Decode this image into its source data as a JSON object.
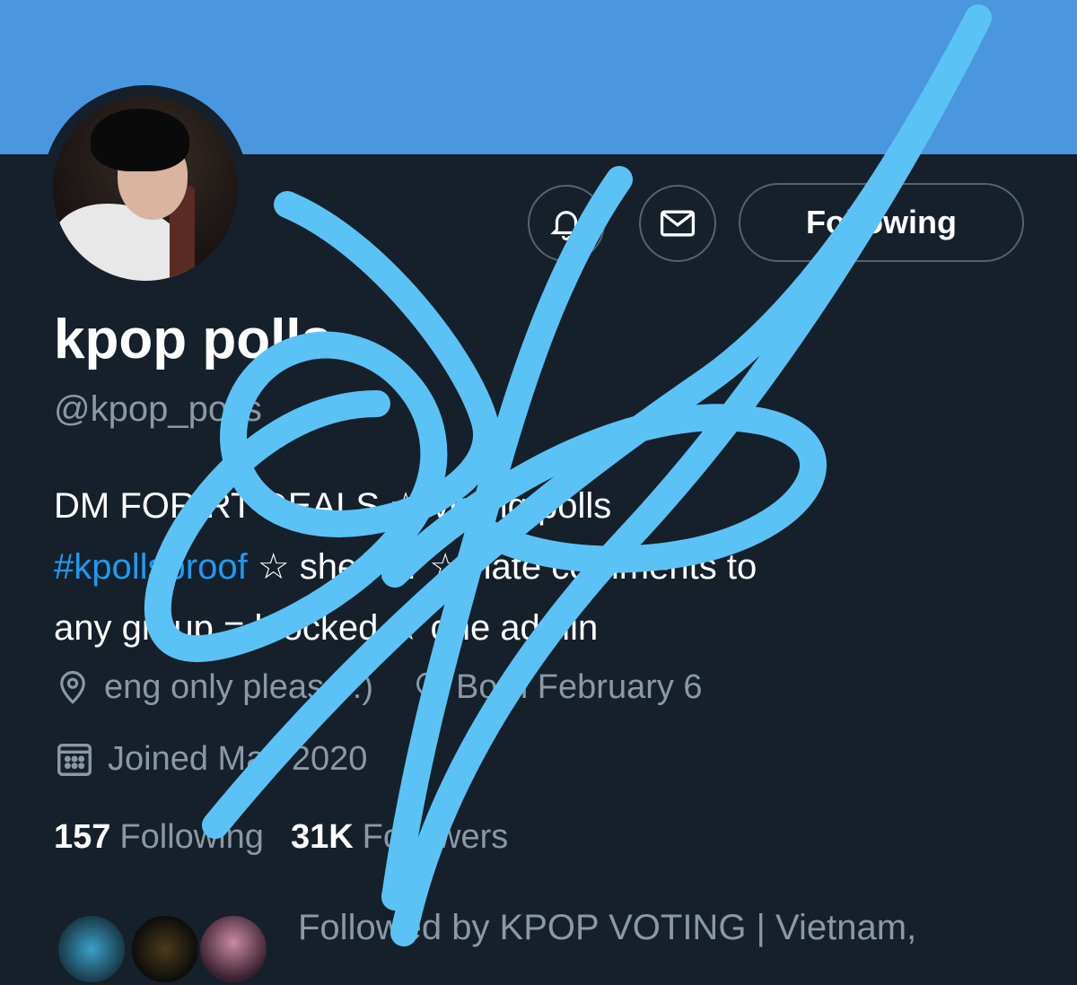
{
  "profile": {
    "name": "kpop polls",
    "handle": "@kpop_polls",
    "bio": {
      "line1": "DM FOR RT DEALS ☆ voting polls",
      "hashtag": "#kpollsproof",
      "line2_rest": " ☆ she/her ☆ hate comments to",
      "line3": "any group = blocked ☆ one admin"
    },
    "location": "eng only please :)",
    "birthday": "Born February 6",
    "joined": "Joined May 2020"
  },
  "actions": {
    "following_label": "Following"
  },
  "stats": {
    "following_count": "157",
    "following_label": "Following",
    "followers_count": "31K",
    "followers_label": "Followers"
  },
  "followed_by": "Followed by KPOP VOTING | Vietnam,",
  "colors": {
    "background": "#15202b",
    "banner": "#4a97e0",
    "accent": "#1d9bf0",
    "muted": "#8b98a5",
    "signature": "#5bc2f5"
  },
  "icons": {
    "bell": "bell-icon",
    "message": "mail-icon",
    "location": "location-pin-icon",
    "birthday": "balloon-icon",
    "calendar": "calendar-icon"
  }
}
